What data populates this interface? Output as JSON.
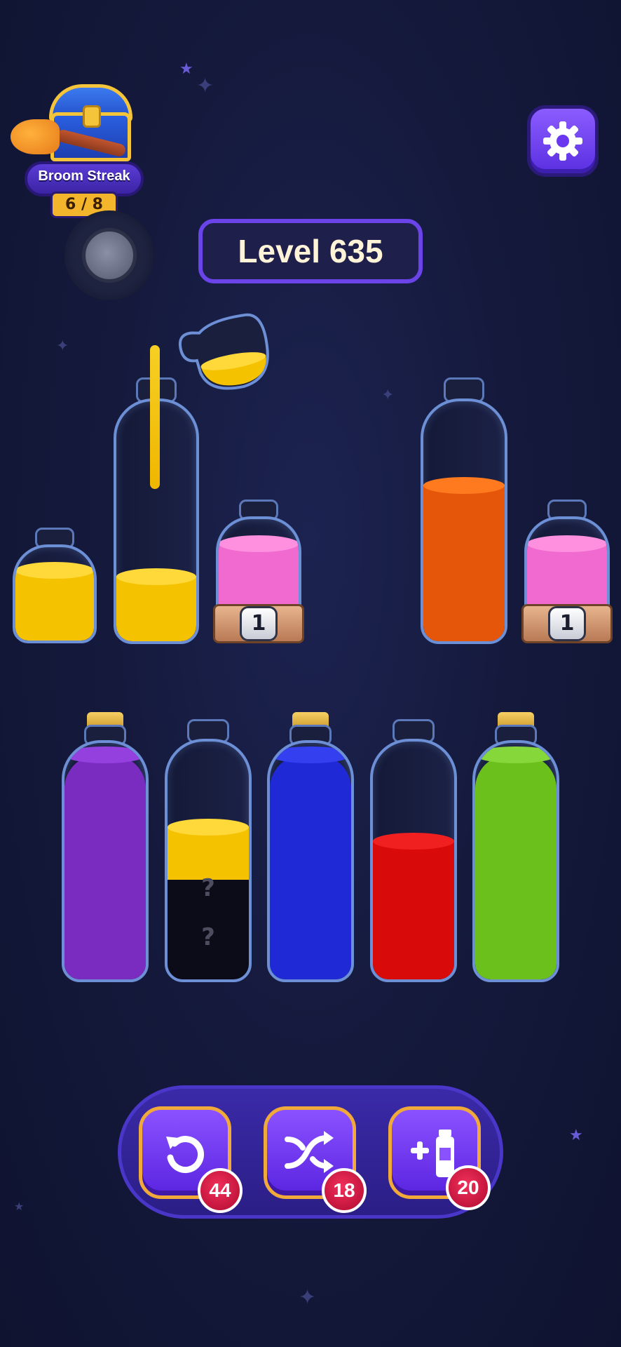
{
  "broom_streak": {
    "title": "Broom Streak",
    "progress": "6 / 8"
  },
  "level": {
    "label": "Level 635"
  },
  "top_row_bottles": [
    {
      "name": "small-yellow",
      "color": "#f5c200",
      "fill": 0.75
    },
    {
      "name": "tall-yellow-receiving",
      "color": "#f5c200",
      "fill": 0.2
    },
    {
      "name": "locked-pink-1",
      "color": "#f06ad0",
      "fill": 0.75,
      "lock": "1"
    },
    {
      "name": "tall-orange",
      "color": "#e6560a",
      "fill": 0.65
    },
    {
      "name": "locked-pink-2",
      "color": "#f06ad0",
      "fill": 0.75,
      "lock": "1"
    }
  ],
  "bottom_row_bottles": [
    {
      "name": "purple",
      "color": "#7a2cc0",
      "fill": 0.95,
      "corked": true
    },
    {
      "name": "mystery-yellow",
      "color": "#f5c200",
      "fill": 0.3,
      "hidden": [
        "?",
        "?"
      ],
      "corked": false
    },
    {
      "name": "blue",
      "color": "#1f2ad6",
      "fill": 0.95,
      "corked": true
    },
    {
      "name": "red",
      "color": "#d80a0a",
      "fill": 0.75,
      "corked": false
    },
    {
      "name": "green",
      "color": "#6cc01c",
      "fill": 0.95,
      "corked": true
    }
  ],
  "pouring": {
    "color": "#f5c200"
  },
  "tools": {
    "undo": {
      "count": "44",
      "icon": "undo-icon"
    },
    "shuffle": {
      "count": "18",
      "icon": "shuffle-icon"
    },
    "add_bottle": {
      "count": "20",
      "icon": "add-bottle-icon"
    }
  },
  "settings": {
    "icon": "gear-icon"
  },
  "colors": {
    "accent": "#6a44e8",
    "badge": "#d01440",
    "background": "#151a3d"
  }
}
